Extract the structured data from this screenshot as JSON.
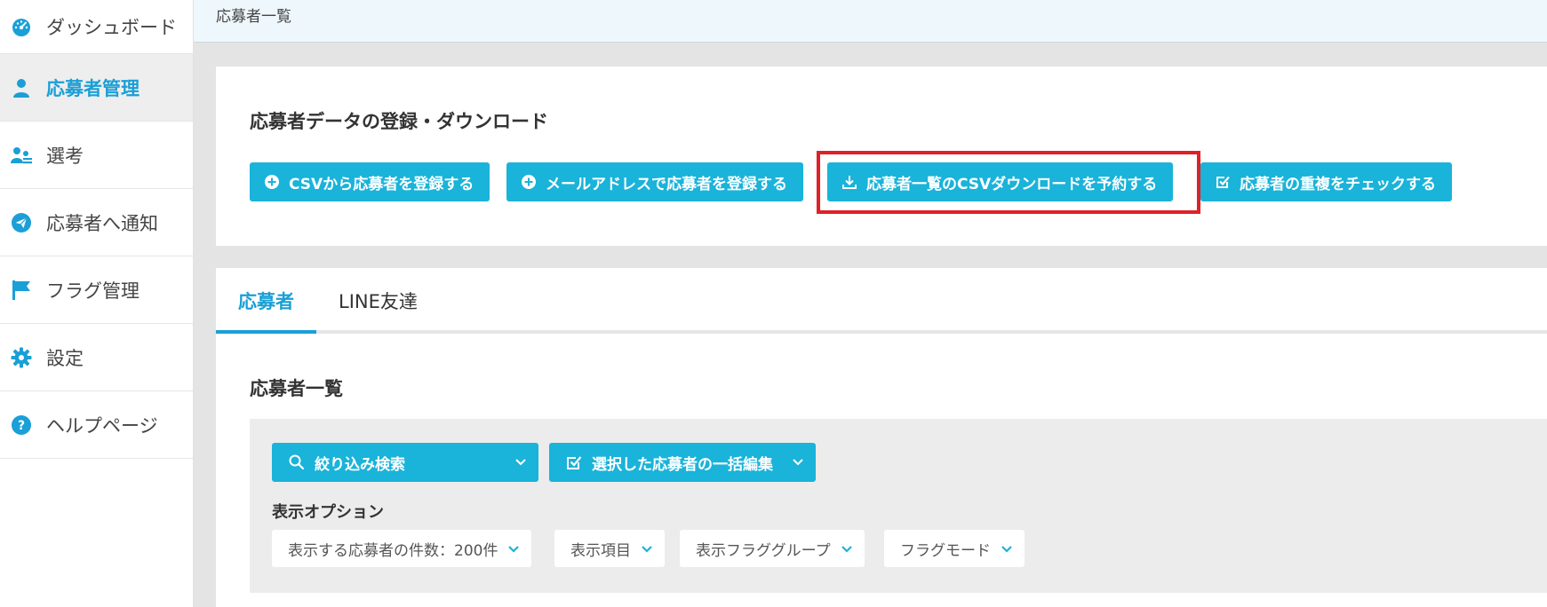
{
  "header": {
    "breadcrumb": "応募者一覧"
  },
  "sidebar": {
    "items": [
      {
        "label": "ダッシュボード",
        "icon": "dashboard-icon"
      },
      {
        "label": "応募者管理",
        "icon": "user-icon",
        "active": true
      },
      {
        "label": "選考",
        "icon": "selection-users-icon"
      },
      {
        "label": "応募者へ通知",
        "icon": "paper-plane-icon"
      },
      {
        "label": "フラグ管理",
        "icon": "flag-icon"
      },
      {
        "label": "設定",
        "icon": "gear-icon"
      },
      {
        "label": "ヘルプページ",
        "icon": "help-icon"
      }
    ]
  },
  "data_section": {
    "title": "応募者データの登録・ダウンロード",
    "buttons": [
      {
        "label": "CSVから応募者を登録する",
        "icon": "plus-circle-icon"
      },
      {
        "label": "メールアドレスで応募者を登録する",
        "icon": "plus-circle-icon"
      },
      {
        "label": "応募者一覧のCSVダウンロードを予約する",
        "icon": "download-icon"
      },
      {
        "label": "応募者の重複をチェックする",
        "icon": "checkbox-icon"
      }
    ]
  },
  "tabs": [
    {
      "label": "応募者",
      "active": true
    },
    {
      "label": "LINE友達"
    }
  ],
  "list": {
    "title": "応募者一覧",
    "filter_button": "絞り込み検索",
    "bulk_edit_button": "選択した応募者の一括編集",
    "display_options_label": "表示オプション",
    "options": [
      "表示する応募者の件数：200件",
      "表示項目",
      "表示フラググループ",
      "フラグモード"
    ]
  },
  "colors": {
    "accent": "#1ab3d9",
    "active_text": "#1a9fd6",
    "highlight": "#e02027"
  }
}
